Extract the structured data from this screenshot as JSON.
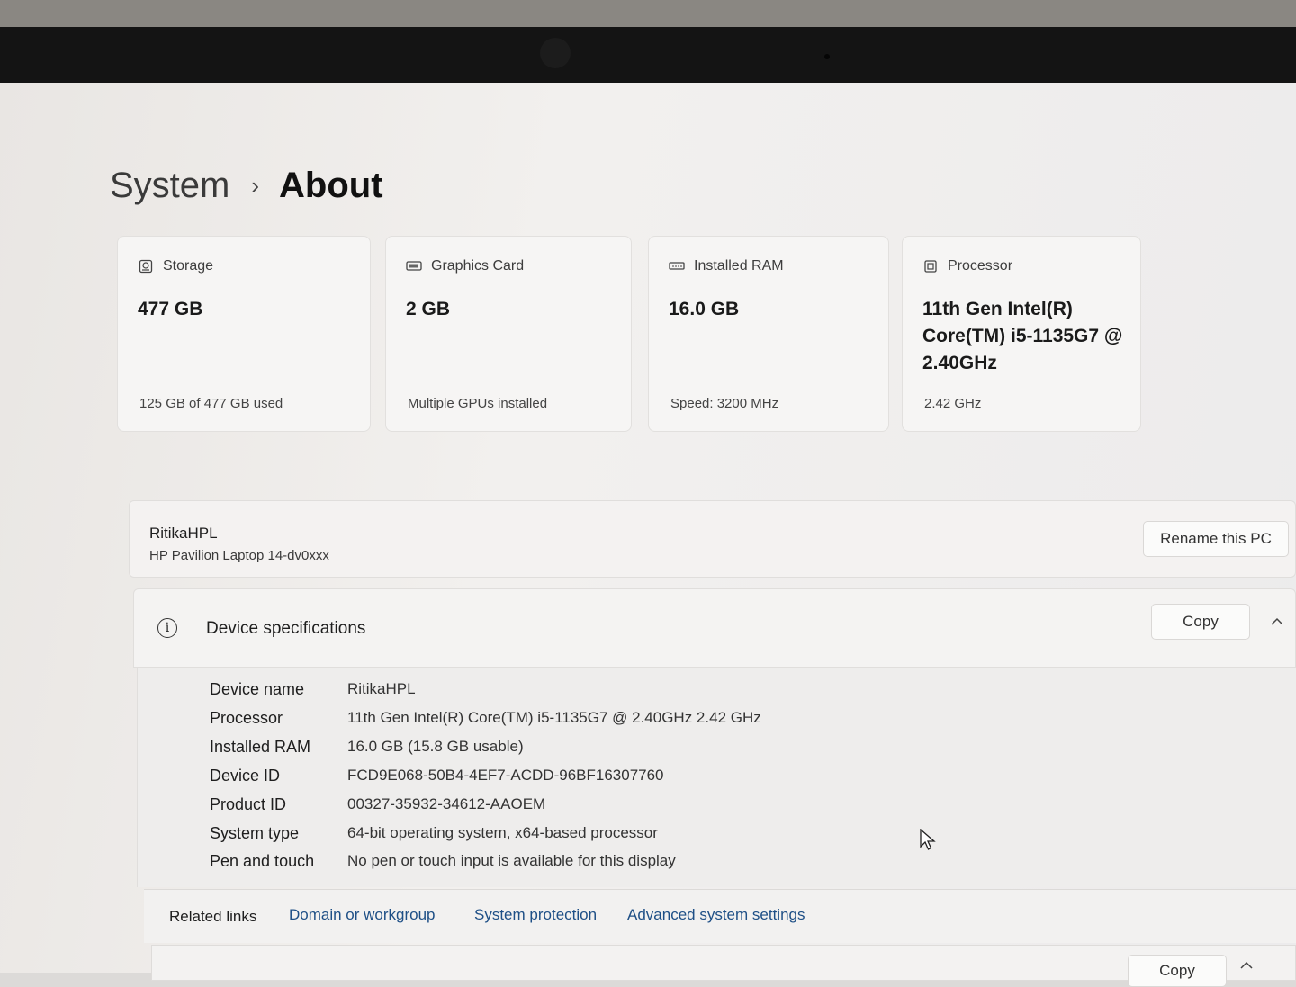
{
  "breadcrumb": {
    "parent": "System",
    "separator": "›",
    "current": "About"
  },
  "cards": {
    "storage": {
      "label": "Storage",
      "value": "477 GB",
      "sub": "125 GB of 477 GB used",
      "icon": "storage-icon"
    },
    "graphics": {
      "label": "Graphics Card",
      "value": "2 GB",
      "sub": "Multiple GPUs installed",
      "icon": "graphics-card-icon"
    },
    "ram": {
      "label": "Installed RAM",
      "value": "16.0 GB",
      "sub": "Speed: 3200 MHz",
      "icon": "ram-icon"
    },
    "processor": {
      "label": "Processor",
      "value": "11th Gen Intel(R) Core(TM) i5-1135G7 @ 2.40GHz",
      "sub": "2.42 GHz",
      "icon": "processor-icon"
    }
  },
  "pc": {
    "name": "RitikaHPL",
    "model": "HP Pavilion Laptop 14-dv0xxx",
    "rename_label": "Rename this PC"
  },
  "specs": {
    "title": "Device specifications",
    "copy_label": "Copy",
    "rows": [
      {
        "label": "Device name",
        "value": "RitikaHPL"
      },
      {
        "label": "Processor",
        "value": "11th Gen Intel(R) Core(TM) i5-1135G7 @ 2.40GHz   2.42 GHz"
      },
      {
        "label": "Installed RAM",
        "value": "16.0 GB (15.8 GB usable)"
      },
      {
        "label": "Device ID",
        "value": "FCD9E068-50B4-4EF7-ACDD-96BF16307760"
      },
      {
        "label": "Product ID",
        "value": "00327-35932-34612-AAOEM"
      },
      {
        "label": "System type",
        "value": "64-bit operating system, x64-based processor"
      },
      {
        "label": "Pen and touch",
        "value": "No pen or touch input is available for this display"
      }
    ]
  },
  "related": {
    "label": "Related links",
    "links": [
      "Domain or workgroup",
      "System protection",
      "Advanced system settings"
    ]
  },
  "next_section": {
    "copy_label": "Copy"
  }
}
